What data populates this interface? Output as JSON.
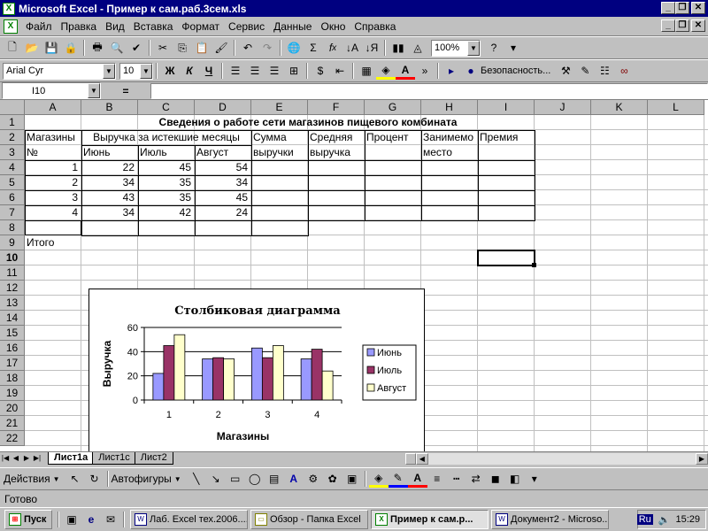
{
  "window": {
    "title": "Microsoft Excel - Пример к сам.раб.3сем.xls",
    "app_icon": "X"
  },
  "menu": [
    "Файл",
    "Правка",
    "Вид",
    "Вставка",
    "Формат",
    "Сервис",
    "Данные",
    "Окно",
    "Справка"
  ],
  "toolbar": {
    "zoom": "100%",
    "font_name": "Arial Cyr",
    "font_size": "10",
    "bold": "Ж",
    "italic": "К",
    "underline": "Ч",
    "security": "Безопасность..."
  },
  "formula": {
    "name_box": "I10",
    "eq": "="
  },
  "columns": [
    "A",
    "B",
    "C",
    "D",
    "E",
    "F",
    "G",
    "H",
    "I",
    "J",
    "K",
    "L"
  ],
  "rows": [
    "1",
    "2",
    "3",
    "4",
    "5",
    "6",
    "7",
    "8",
    "9",
    "10",
    "11",
    "12",
    "13",
    "14",
    "15",
    "16",
    "17",
    "18",
    "19",
    "20",
    "21",
    "22"
  ],
  "sheet": {
    "title": "Сведения о работе сети магазинов пищевого комбината",
    "h_shops": "Магазины",
    "h_no": "№",
    "h_revenue": "Выручка за истекшие месяцы",
    "h_jun": "Июнь",
    "h_jul": "Июль",
    "h_aug": "Август",
    "h_sum1": "Сумма",
    "h_sum2": "выручки",
    "h_avg1": "Средняя",
    "h_avg2": "выручка",
    "h_pct": "Процент",
    "h_place1": "Занимемо",
    "h_place2": "место",
    "h_bonus": "Премия",
    "data_rows": [
      [
        "1",
        "22",
        "45",
        "54"
      ],
      [
        "2",
        "34",
        "35",
        "34"
      ],
      [
        "3",
        "43",
        "35",
        "45"
      ],
      [
        "4",
        "34",
        "42",
        "24"
      ]
    ],
    "total": "Итого"
  },
  "chart_data": {
    "type": "bar",
    "title": "Столбиковая диаграмма",
    "categories": [
      "1",
      "2",
      "3",
      "4"
    ],
    "series": [
      {
        "name": "Июнь",
        "values": [
          22,
          34,
          43,
          34
        ],
        "color": "#9999ff"
      },
      {
        "name": "Июль",
        "values": [
          45,
          35,
          35,
          42
        ],
        "color": "#993366"
      },
      {
        "name": "Август",
        "values": [
          54,
          34,
          45,
          24
        ],
        "color": "#ffffcc"
      }
    ],
    "xlabel": "Магазины",
    "ylabel": "Выручка",
    "ylim": [
      0,
      60
    ],
    "yticks": [
      "0",
      "20",
      "40",
      "60"
    ],
    "grid": true,
    "legend": "right"
  },
  "tabs": [
    "Лист1а",
    "Лист1с",
    "Лист2"
  ],
  "drawbar": {
    "actions": "Действия",
    "autoshapes": "Автофигуры"
  },
  "status": "Готово",
  "taskbar": {
    "start": "Пуск",
    "tasks": [
      "Лаб. Excel тех.2006....",
      "Обзор - Папка Excel",
      "Пример к сам.р...",
      "Документ2 - Microso..."
    ],
    "lang": "Ru",
    "clock": "15:29"
  }
}
